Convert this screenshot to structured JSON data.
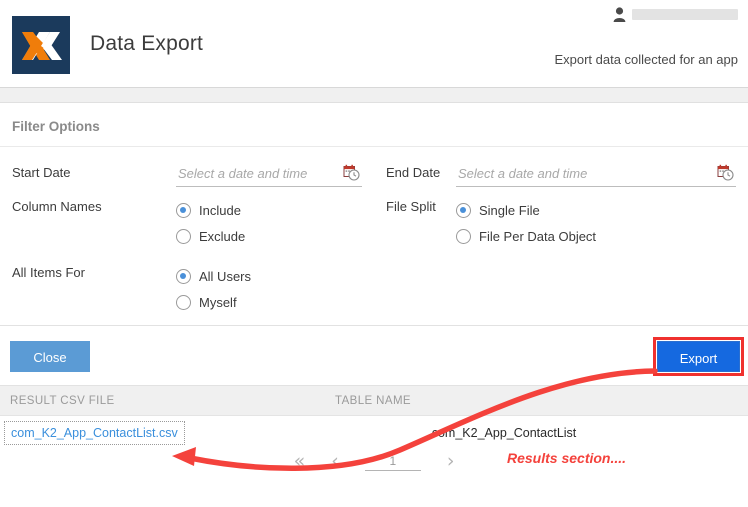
{
  "header": {
    "logo_name": "k2-logo",
    "title": "Data Export",
    "subtitle": "Export data collected for an app",
    "user_icon": "user-icon",
    "user_name": ""
  },
  "filter": {
    "section_title": "Filter Options",
    "start_date": {
      "label": "Start Date",
      "value": "",
      "placeholder": "Select a date and time",
      "icon": "calendar-clock-icon"
    },
    "end_date": {
      "label": "End Date",
      "value": "",
      "placeholder": "Select a date and time",
      "icon": "calendar-clock-icon"
    },
    "column_names": {
      "label": "Column Names",
      "options": [
        "Include",
        "Exclude"
      ],
      "selected": "Include"
    },
    "file_split": {
      "label": "File Split",
      "options": [
        "Single File",
        "File Per Data Object"
      ],
      "selected": "Single File"
    },
    "all_items_for": {
      "label": "All Items For",
      "options": [
        "All Users",
        "Myself"
      ],
      "selected": "All Users"
    }
  },
  "actions": {
    "close_label": "Close",
    "export_label": "Export",
    "close_color": "#5b9bd5",
    "export_color": "#1569e0",
    "highlight_color": "#f0312e"
  },
  "results": {
    "columns": [
      "RESULT CSV FILE",
      "TABLE NAME"
    ],
    "rows": [
      {
        "csv_file": "com_K2_App_ContactList.csv",
        "table_name": "com_K2_App_ContactList"
      }
    ],
    "pagination": {
      "first_icon": "«",
      "prev_icon": "‹",
      "next_icon": "›",
      "page_value": "1"
    }
  },
  "annotations": {
    "results_note": "Results section....",
    "arrow_color": "#f4423c",
    "arrow_name": "red-curved-arrow"
  }
}
